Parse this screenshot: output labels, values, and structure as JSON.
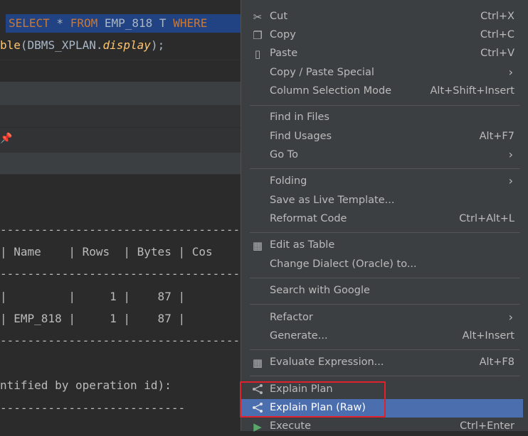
{
  "editor": {
    "line1": {
      "k1": "SELECT",
      "star": " * ",
      "k2": "FROM",
      "tbl": " EMP_818 T ",
      "k3": "WHERE"
    },
    "line2": {
      "fn": "ble",
      "args": "(DBMS_XPLAN.",
      "it": "display",
      "end": ");"
    }
  },
  "output": {
    "dash1": "-------------------------------------",
    "header": "| Name    | Rows  | Bytes | Cos",
    "dash2": "-------------------------------------",
    "row1": "|         |     1 |    87 |",
    "row2": "| EMP_818 |     1 |    87 |",
    "dash3": "-------------------------------------",
    "note": "ntified by operation id):",
    "dash4": "---------------------------"
  },
  "menu": {
    "items": [
      {
        "label": "Cut",
        "shortcut": "Ctrl+X",
        "icon": "scissors-icon"
      },
      {
        "label": "Copy",
        "shortcut": "Ctrl+C",
        "icon": "copy-icon"
      },
      {
        "label": "Paste",
        "shortcut": "Ctrl+V",
        "icon": "clipboard-icon"
      },
      {
        "label": "Copy / Paste Special",
        "submenu": true
      },
      {
        "label": "Column Selection Mode",
        "shortcut": "Alt+Shift+Insert"
      },
      {
        "label": "Find in Files"
      },
      {
        "label": "Find Usages",
        "shortcut": "Alt+F7"
      },
      {
        "label": "Go To",
        "submenu": true
      },
      {
        "label": "Folding",
        "submenu": true
      },
      {
        "label": "Save as Live Template..."
      },
      {
        "label": "Reformat Code",
        "shortcut": "Ctrl+Alt+L"
      },
      {
        "label": "Edit as Table",
        "icon": "table-icon"
      },
      {
        "label": "Change Dialect (Oracle) to..."
      },
      {
        "label": "Search with Google"
      },
      {
        "label": "Refactor",
        "submenu": true
      },
      {
        "label": "Generate...",
        "shortcut": "Alt+Insert"
      },
      {
        "label": "Evaluate Expression...",
        "shortcut": "Alt+F8",
        "icon": "calculator-icon"
      },
      {
        "label": "Explain Plan",
        "icon": "plan-tree-icon"
      },
      {
        "label": "Explain Plan (Raw)",
        "icon": "plan-tree-icon",
        "selected": true
      },
      {
        "label": "Execute",
        "shortcut": "Ctrl+Enter",
        "icon": "run-icon"
      }
    ]
  },
  "colors": {
    "selection": "#4b6eaf",
    "highlight_box": "#e0202a",
    "run": "#59a869"
  }
}
